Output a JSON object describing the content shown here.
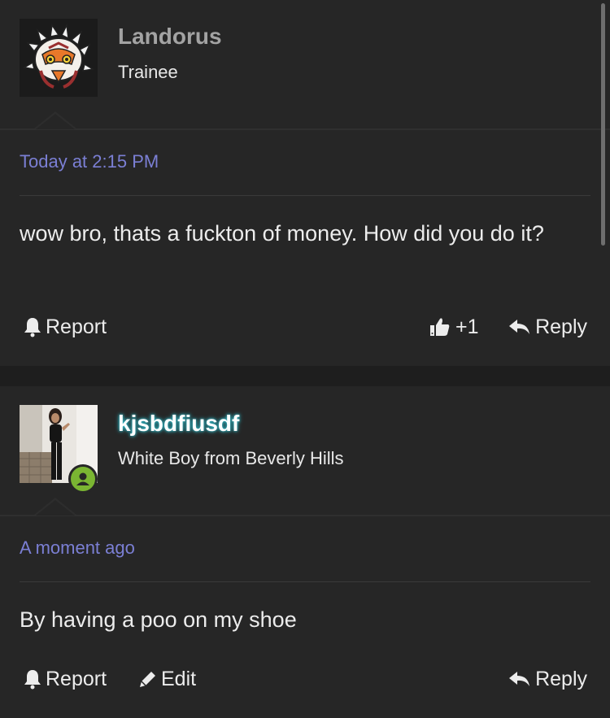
{
  "posts": [
    {
      "username": "Landorus",
      "user_title": "Trainee",
      "timestamp": "Today at 2:15 PM",
      "message": "wow bro, thats a fuckton of money. How did you do it?",
      "actions": {
        "report_label": "Report",
        "like_label": "+1",
        "reply_label": "Reply"
      }
    },
    {
      "username": "kjsbdfiusdf",
      "user_title": "White Boy from Beverly Hills",
      "timestamp": "A moment ago",
      "message": "By having a poo on my shoe",
      "actions": {
        "report_label": "Report",
        "edit_label": "Edit",
        "reply_label": "Reply"
      },
      "online_status": "online"
    }
  ],
  "colors": {
    "background": "#1f1f1f",
    "post_background": "#262626",
    "timestamp": "#7b7fd4",
    "username_glow": "#2fb8c6",
    "online": "#7ab532"
  },
  "icons": [
    "bell-icon",
    "thumbs-up-icon",
    "reply-arrow-icon",
    "pencil-icon",
    "user-status-icon"
  ]
}
